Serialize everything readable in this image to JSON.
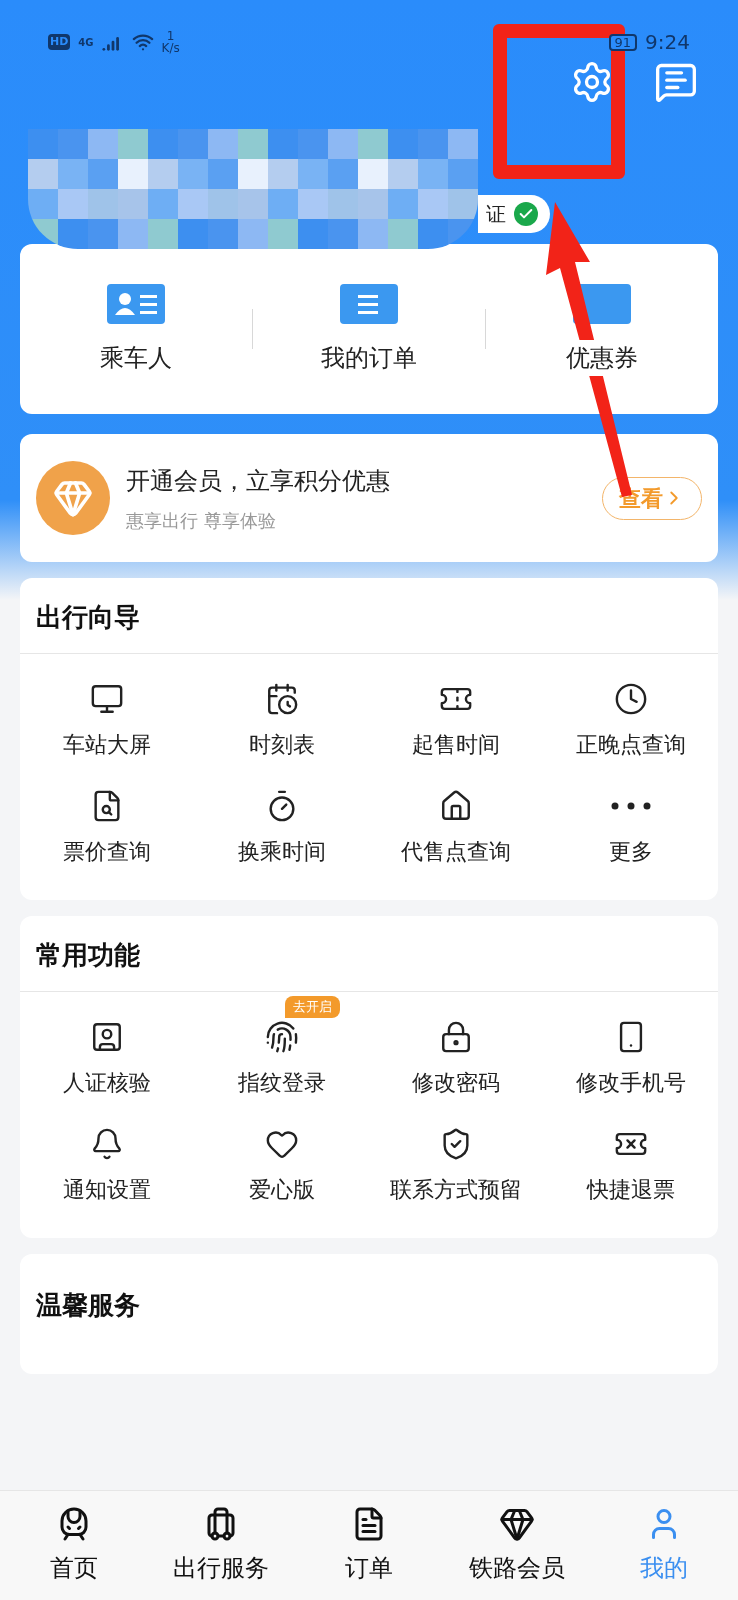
{
  "status_bar": {
    "hd": "HD",
    "network": "4G",
    "speed_value": "1",
    "speed_unit": "K/s",
    "battery": "91",
    "time": "9:24"
  },
  "profile": {
    "verified_label": "证",
    "verified": true
  },
  "quick_links": [
    {
      "label": "乘车人"
    },
    {
      "label": "我的订单"
    },
    {
      "label": "优惠券"
    }
  ],
  "membership": {
    "title": "开通会员，立享积分优惠",
    "subtitle": "惠享出行 尊享体验",
    "button": "查看"
  },
  "travel_guide": {
    "title": "出行向导",
    "items": [
      {
        "label": "车站大屏"
      },
      {
        "label": "时刻表"
      },
      {
        "label": "起售时间"
      },
      {
        "label": "正晚点查询"
      },
      {
        "label": "票价查询"
      },
      {
        "label": "换乘时间"
      },
      {
        "label": "代售点查询"
      },
      {
        "label": "更多"
      }
    ]
  },
  "common_functions": {
    "title": "常用功能",
    "items": [
      {
        "label": "人证核验"
      },
      {
        "label": "指纹登录",
        "badge": "去开启"
      },
      {
        "label": "修改密码"
      },
      {
        "label": "修改手机号"
      },
      {
        "label": "通知设置"
      },
      {
        "label": "爱心版"
      },
      {
        "label": "联系方式预留"
      },
      {
        "label": "快捷退票"
      }
    ]
  },
  "warm_service": {
    "title": "温馨服务"
  },
  "bottom_nav": [
    {
      "label": "首页",
      "selected": false
    },
    {
      "label": "出行服务",
      "selected": false
    },
    {
      "label": "订单",
      "selected": false
    },
    {
      "label": "铁路会员",
      "selected": false
    },
    {
      "label": "我的",
      "selected": true
    }
  ]
}
